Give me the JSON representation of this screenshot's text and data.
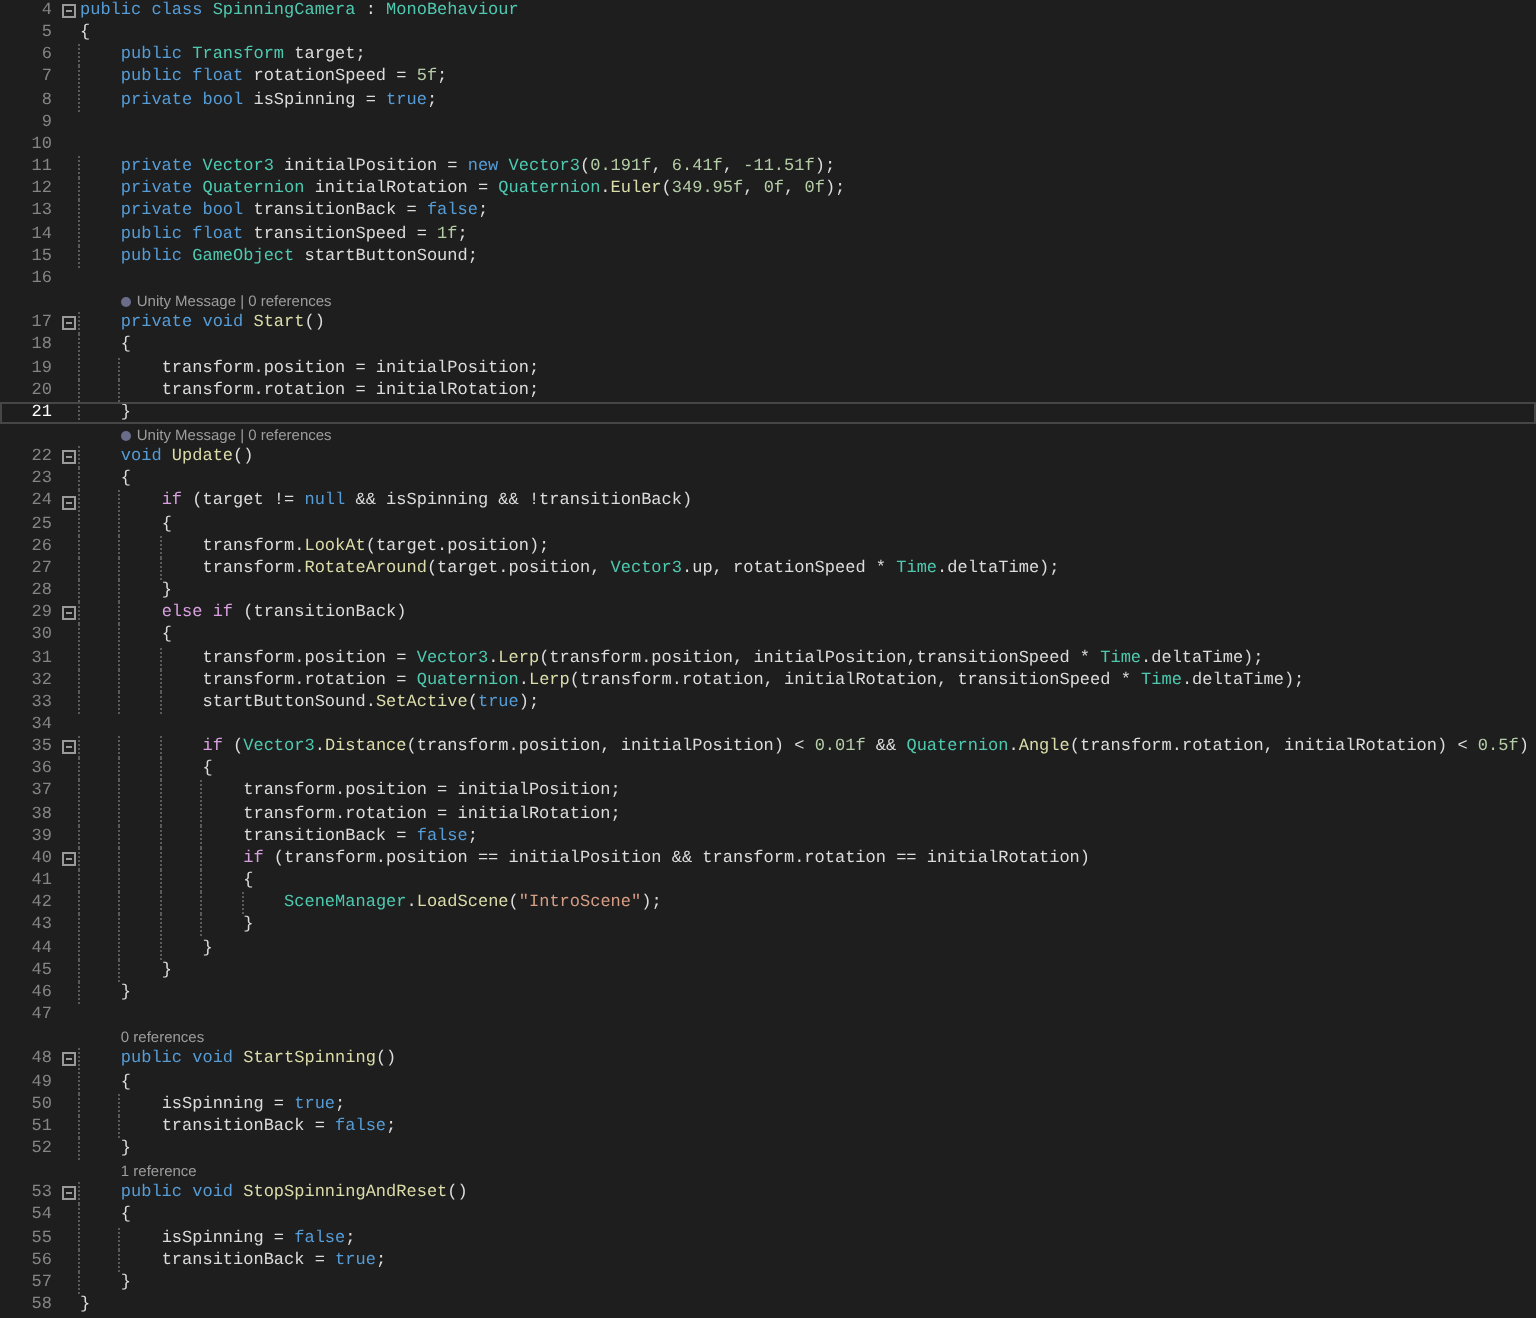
{
  "editor": {
    "lines": [
      {
        "kind": "code",
        "number": "4",
        "fold": true,
        "current": false,
        "tokens": [
          {
            "kind": "kw",
            "text": "public class "
          },
          {
            "kind": "type",
            "text": "SpinningCamera"
          },
          {
            "kind": "txt",
            "text": " : "
          },
          {
            "kind": "type",
            "text": "MonoBehaviour"
          }
        ]
      },
      {
        "kind": "code",
        "number": "5",
        "fold": false,
        "current": false,
        "tokens": [
          {
            "kind": "txt",
            "text": "{"
          }
        ]
      },
      {
        "kind": "code",
        "number": "6",
        "fold": false,
        "current": false,
        "tokens": [
          {
            "kind": "kw",
            "text": "    public "
          },
          {
            "kind": "type",
            "text": "Transform"
          },
          {
            "kind": "txt",
            "text": " target;"
          }
        ]
      },
      {
        "kind": "code",
        "number": "7",
        "fold": false,
        "current": false,
        "tokens": [
          {
            "kind": "kw",
            "text": "    public float"
          },
          {
            "kind": "txt",
            "text": " rotationSpeed = "
          },
          {
            "kind": "num",
            "text": "5f"
          },
          {
            "kind": "txt",
            "text": ";"
          }
        ]
      },
      {
        "kind": "code",
        "number": "8",
        "fold": false,
        "current": false,
        "tokens": [
          {
            "kind": "kw",
            "text": "    private bool"
          },
          {
            "kind": "txt",
            "text": " isSpinning = "
          },
          {
            "kind": "kw",
            "text": "true"
          },
          {
            "kind": "txt",
            "text": ";"
          }
        ]
      },
      {
        "kind": "code",
        "number": "9",
        "fold": false,
        "current": false
      },
      {
        "kind": "code",
        "number": "10",
        "fold": false,
        "current": false
      },
      {
        "kind": "code",
        "number": "11",
        "fold": false,
        "current": false,
        "tokens": [
          {
            "kind": "kw",
            "text": "    private "
          },
          {
            "kind": "type",
            "text": "Vector3"
          },
          {
            "kind": "txt",
            "text": " initialPosition = "
          },
          {
            "kind": "kw",
            "text": "new "
          },
          {
            "kind": "type",
            "text": "Vector3"
          },
          {
            "kind": "txt",
            "text": "("
          },
          {
            "kind": "num",
            "text": "0.191f"
          },
          {
            "kind": "txt",
            "text": ", "
          },
          {
            "kind": "num",
            "text": "6.41f"
          },
          {
            "kind": "txt",
            "text": ", "
          },
          {
            "kind": "num",
            "text": "-11.51f"
          },
          {
            "kind": "txt",
            "text": ");"
          }
        ]
      },
      {
        "kind": "code",
        "number": "12",
        "fold": false,
        "current": false,
        "tokens": [
          {
            "kind": "kw",
            "text": "    private "
          },
          {
            "kind": "type",
            "text": "Quaternion"
          },
          {
            "kind": "txt",
            "text": " initialRotation = "
          },
          {
            "kind": "type",
            "text": "Quaternion"
          },
          {
            "kind": "txt",
            "text": "."
          },
          {
            "kind": "fn",
            "text": "Euler"
          },
          {
            "kind": "txt",
            "text": "("
          },
          {
            "kind": "num",
            "text": "349.95f"
          },
          {
            "kind": "txt",
            "text": ", "
          },
          {
            "kind": "num",
            "text": "0f"
          },
          {
            "kind": "txt",
            "text": ", "
          },
          {
            "kind": "num",
            "text": "0f"
          },
          {
            "kind": "txt",
            "text": ");"
          }
        ]
      },
      {
        "kind": "code",
        "number": "13",
        "fold": false,
        "current": false,
        "tokens": [
          {
            "kind": "kw",
            "text": "    private bool"
          },
          {
            "kind": "txt",
            "text": " transitionBack = "
          },
          {
            "kind": "kw",
            "text": "false"
          },
          {
            "kind": "txt",
            "text": ";"
          }
        ]
      },
      {
        "kind": "code",
        "number": "14",
        "fold": false,
        "current": false,
        "tokens": [
          {
            "kind": "kw",
            "text": "    public float"
          },
          {
            "kind": "txt",
            "text": " transitionSpeed = "
          },
          {
            "kind": "num",
            "text": "1f"
          },
          {
            "kind": "txt",
            "text": ";"
          }
        ]
      },
      {
        "kind": "code",
        "number": "15",
        "fold": false,
        "current": false,
        "tokens": [
          {
            "kind": "kw",
            "text": "    public "
          },
          {
            "kind": "type",
            "text": "GameObject"
          },
          {
            "kind": "txt",
            "text": " startButtonSound;"
          }
        ]
      },
      {
        "kind": "code",
        "number": "16",
        "fold": false,
        "current": false
      },
      {
        "kind": "lens",
        "icon": true,
        "text": "Unity Message | 0 references"
      },
      {
        "kind": "code",
        "number": "17",
        "fold": true,
        "current": false,
        "tokens": [
          {
            "kind": "kw",
            "text": "    private void "
          },
          {
            "kind": "fn",
            "text": "Start"
          },
          {
            "kind": "txt",
            "text": "()"
          }
        ]
      },
      {
        "kind": "code",
        "number": "18",
        "fold": false,
        "current": false,
        "tokens": [
          {
            "kind": "txt",
            "text": "    {"
          }
        ]
      },
      {
        "kind": "code",
        "number": "19",
        "fold": false,
        "current": false,
        "tokens": [
          {
            "kind": "txt",
            "text": "        transform.position = initialPosition;"
          }
        ]
      },
      {
        "kind": "code",
        "number": "20",
        "fold": false,
        "current": false,
        "tokens": [
          {
            "kind": "txt",
            "text": "        transform.rotation = initialRotation;"
          }
        ]
      },
      {
        "kind": "code",
        "number": "21",
        "fold": false,
        "current": true,
        "tokens": [
          {
            "kind": "txt",
            "text": "    }"
          }
        ]
      },
      {
        "kind": "lens",
        "icon": true,
        "text": "Unity Message | 0 references"
      },
      {
        "kind": "code",
        "number": "22",
        "fold": true,
        "current": false,
        "tokens": [
          {
            "kind": "kw",
            "text": "    void "
          },
          {
            "kind": "fn",
            "text": "Update"
          },
          {
            "kind": "txt",
            "text": "()"
          }
        ]
      },
      {
        "kind": "code",
        "number": "23",
        "fold": false,
        "current": false,
        "tokens": [
          {
            "kind": "txt",
            "text": "    {"
          }
        ]
      },
      {
        "kind": "code",
        "number": "24",
        "fold": true,
        "current": false,
        "tokens": [
          {
            "kind": "ctl",
            "text": "        if"
          },
          {
            "kind": "txt",
            "text": " (target != "
          },
          {
            "kind": "kw",
            "text": "null"
          },
          {
            "kind": "txt",
            "text": " && isSpinning && !transitionBack)"
          }
        ]
      },
      {
        "kind": "code",
        "number": "25",
        "fold": false,
        "current": false,
        "tokens": [
          {
            "kind": "txt",
            "text": "        {"
          }
        ]
      },
      {
        "kind": "code",
        "number": "26",
        "fold": false,
        "current": false,
        "tokens": [
          {
            "kind": "txt",
            "text": "            transform."
          },
          {
            "kind": "fn",
            "text": "LookAt"
          },
          {
            "kind": "txt",
            "text": "(target.position);"
          }
        ]
      },
      {
        "kind": "code",
        "number": "27",
        "fold": false,
        "current": false,
        "tokens": [
          {
            "kind": "txt",
            "text": "            transform."
          },
          {
            "kind": "fn",
            "text": "RotateAround"
          },
          {
            "kind": "txt",
            "text": "(target.position, "
          },
          {
            "kind": "type",
            "text": "Vector3"
          },
          {
            "kind": "txt",
            "text": ".up, rotationSpeed * "
          },
          {
            "kind": "type",
            "text": "Time"
          },
          {
            "kind": "txt",
            "text": ".deltaTime);"
          }
        ]
      },
      {
        "kind": "code",
        "number": "28",
        "fold": false,
        "current": false,
        "tokens": [
          {
            "kind": "txt",
            "text": "        }"
          }
        ]
      },
      {
        "kind": "code",
        "number": "29",
        "fold": true,
        "current": false,
        "tokens": [
          {
            "kind": "ctl",
            "text": "        else if"
          },
          {
            "kind": "txt",
            "text": " (transitionBack)"
          }
        ]
      },
      {
        "kind": "code",
        "number": "30",
        "fold": false,
        "current": false,
        "tokens": [
          {
            "kind": "txt",
            "text": "        {"
          }
        ]
      },
      {
        "kind": "code",
        "number": "31",
        "fold": false,
        "current": false,
        "tokens": [
          {
            "kind": "txt",
            "text": "            transform.position = "
          },
          {
            "kind": "type",
            "text": "Vector3"
          },
          {
            "kind": "txt",
            "text": "."
          },
          {
            "kind": "fn",
            "text": "Lerp"
          },
          {
            "kind": "txt",
            "text": "(transform.position, initialPosition,transitionSpeed * "
          },
          {
            "kind": "type",
            "text": "Time"
          },
          {
            "kind": "txt",
            "text": ".deltaTime);"
          }
        ]
      },
      {
        "kind": "code",
        "number": "32",
        "fold": false,
        "current": false,
        "tokens": [
          {
            "kind": "txt",
            "text": "            transform.rotation = "
          },
          {
            "kind": "type",
            "text": "Quaternion"
          },
          {
            "kind": "txt",
            "text": "."
          },
          {
            "kind": "fn",
            "text": "Lerp"
          },
          {
            "kind": "txt",
            "text": "(transform.rotation, initialRotation, transitionSpeed * "
          },
          {
            "kind": "type",
            "text": "Time"
          },
          {
            "kind": "txt",
            "text": ".deltaTime);"
          }
        ]
      },
      {
        "kind": "code",
        "number": "33",
        "fold": false,
        "current": false,
        "tokens": [
          {
            "kind": "txt",
            "text": "            startButtonSound."
          },
          {
            "kind": "fn",
            "text": "SetActive"
          },
          {
            "kind": "txt",
            "text": "("
          },
          {
            "kind": "kw",
            "text": "true"
          },
          {
            "kind": "txt",
            "text": ");"
          }
        ]
      },
      {
        "kind": "code",
        "number": "34",
        "fold": false,
        "current": false
      },
      {
        "kind": "code",
        "number": "35",
        "fold": true,
        "current": false,
        "tokens": [
          {
            "kind": "ctl",
            "text": "            if"
          },
          {
            "kind": "txt",
            "text": " ("
          },
          {
            "kind": "type",
            "text": "Vector3"
          },
          {
            "kind": "txt",
            "text": "."
          },
          {
            "kind": "fn",
            "text": "Distance"
          },
          {
            "kind": "txt",
            "text": "(transform.position, initialPosition) < "
          },
          {
            "kind": "num",
            "text": "0.01f"
          },
          {
            "kind": "txt",
            "text": " && "
          },
          {
            "kind": "type",
            "text": "Quaternion"
          },
          {
            "kind": "txt",
            "text": "."
          },
          {
            "kind": "fn",
            "text": "Angle"
          },
          {
            "kind": "txt",
            "text": "(transform.rotation, initialRotation) < "
          },
          {
            "kind": "num",
            "text": "0.5f"
          },
          {
            "kind": "txt",
            "text": ")"
          }
        ]
      },
      {
        "kind": "code",
        "number": "36",
        "fold": false,
        "current": false,
        "tokens": [
          {
            "kind": "txt",
            "text": "            {"
          }
        ]
      },
      {
        "kind": "code",
        "number": "37",
        "fold": false,
        "current": false,
        "tokens": [
          {
            "kind": "txt",
            "text": "                transform.position = initialPosition;"
          }
        ]
      },
      {
        "kind": "code",
        "number": "38",
        "fold": false,
        "current": false,
        "tokens": [
          {
            "kind": "txt",
            "text": "                transform.rotation = initialRotation;"
          }
        ]
      },
      {
        "kind": "code",
        "number": "39",
        "fold": false,
        "current": false,
        "tokens": [
          {
            "kind": "txt",
            "text": "                transitionBack = "
          },
          {
            "kind": "kw",
            "text": "false"
          },
          {
            "kind": "txt",
            "text": ";"
          }
        ]
      },
      {
        "kind": "code",
        "number": "40",
        "fold": true,
        "current": false,
        "tokens": [
          {
            "kind": "ctl",
            "text": "                if"
          },
          {
            "kind": "txt",
            "text": " (transform.position == initialPosition && transform.rotation == initialRotation)"
          }
        ]
      },
      {
        "kind": "code",
        "number": "41",
        "fold": false,
        "current": false,
        "tokens": [
          {
            "kind": "txt",
            "text": "                {"
          }
        ]
      },
      {
        "kind": "code",
        "number": "42",
        "fold": false,
        "current": false,
        "tokens": [
          {
            "kind": "type",
            "text": "                    SceneManager"
          },
          {
            "kind": "txt",
            "text": "."
          },
          {
            "kind": "fn",
            "text": "LoadScene"
          },
          {
            "kind": "txt",
            "text": "("
          },
          {
            "kind": "str",
            "text": "\"IntroScene\""
          },
          {
            "kind": "txt",
            "text": ");"
          }
        ]
      },
      {
        "kind": "code",
        "number": "43",
        "fold": false,
        "current": false,
        "tokens": [
          {
            "kind": "txt",
            "text": "                }"
          }
        ]
      },
      {
        "kind": "code",
        "number": "44",
        "fold": false,
        "current": false,
        "tokens": [
          {
            "kind": "txt",
            "text": "            }"
          }
        ]
      },
      {
        "kind": "code",
        "number": "45",
        "fold": false,
        "current": false,
        "tokens": [
          {
            "kind": "txt",
            "text": "        }"
          }
        ]
      },
      {
        "kind": "code",
        "number": "46",
        "fold": false,
        "current": false,
        "tokens": [
          {
            "kind": "txt",
            "text": "    }"
          }
        ]
      },
      {
        "kind": "code",
        "number": "47",
        "fold": false,
        "current": false
      },
      {
        "kind": "lens",
        "icon": false,
        "text": "0 references"
      },
      {
        "kind": "code",
        "number": "48",
        "fold": true,
        "current": false,
        "tokens": [
          {
            "kind": "kw",
            "text": "    public void "
          },
          {
            "kind": "fn",
            "text": "StartSpinning"
          },
          {
            "kind": "txt",
            "text": "()"
          }
        ]
      },
      {
        "kind": "code",
        "number": "49",
        "fold": false,
        "current": false,
        "tokens": [
          {
            "kind": "txt",
            "text": "    {"
          }
        ]
      },
      {
        "kind": "code",
        "number": "50",
        "fold": false,
        "current": false,
        "tokens": [
          {
            "kind": "txt",
            "text": "        isSpinning = "
          },
          {
            "kind": "kw",
            "text": "true"
          },
          {
            "kind": "txt",
            "text": ";"
          }
        ]
      },
      {
        "kind": "code",
        "number": "51",
        "fold": false,
        "current": false,
        "tokens": [
          {
            "kind": "txt",
            "text": "        transitionBack = "
          },
          {
            "kind": "kw",
            "text": "false"
          },
          {
            "kind": "txt",
            "text": ";"
          }
        ]
      },
      {
        "kind": "code",
        "number": "52",
        "fold": false,
        "current": false,
        "tokens": [
          {
            "kind": "txt",
            "text": "    }"
          }
        ]
      },
      {
        "kind": "lens",
        "icon": false,
        "text": "1 reference"
      },
      {
        "kind": "code",
        "number": "53",
        "fold": true,
        "current": false,
        "tokens": [
          {
            "kind": "kw",
            "text": "    public void "
          },
          {
            "kind": "fn",
            "text": "StopSpinningAndReset"
          },
          {
            "kind": "txt",
            "text": "()"
          }
        ]
      },
      {
        "kind": "code",
        "number": "54",
        "fold": false,
        "current": false,
        "tokens": [
          {
            "kind": "txt",
            "text": "    {"
          }
        ]
      },
      {
        "kind": "code",
        "number": "55",
        "fold": false,
        "current": false,
        "tokens": [
          {
            "kind": "txt",
            "text": "        isSpinning = "
          },
          {
            "kind": "kw",
            "text": "false"
          },
          {
            "kind": "txt",
            "text": ";"
          }
        ]
      },
      {
        "kind": "code",
        "number": "56",
        "fold": false,
        "current": false,
        "tokens": [
          {
            "kind": "txt",
            "text": "        transitionBack = "
          },
          {
            "kind": "kw",
            "text": "true"
          },
          {
            "kind": "txt",
            "text": ";"
          }
        ]
      },
      {
        "kind": "code",
        "number": "57",
        "fold": false,
        "current": false,
        "tokens": [
          {
            "kind": "txt",
            "text": "    }"
          }
        ]
      },
      {
        "kind": "code",
        "number": "58",
        "fold": false,
        "current": false,
        "tokens": [
          {
            "kind": "txt",
            "text": "}"
          }
        ]
      }
    ]
  }
}
